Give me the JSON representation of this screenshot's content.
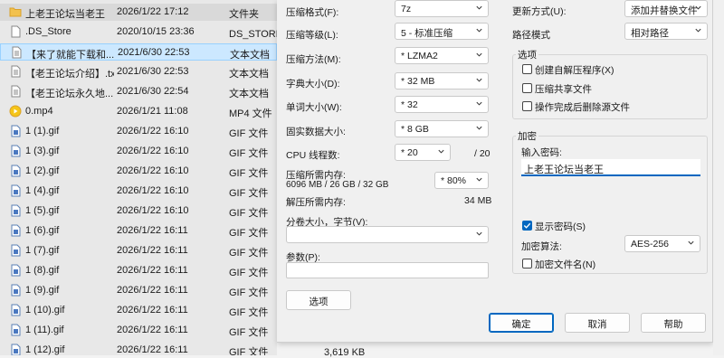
{
  "files": [
    {
      "name": "上老王论坛当老王",
      "date": "2026/1/22 17:12",
      "type": "文件夹",
      "icon": "folder-icon"
    },
    {
      "name": ".DS_Store",
      "date": "2020/10/15 23:36",
      "type": "DS_STORE 文件",
      "icon": "file-icon"
    },
    {
      "name": "【来了就能下载和...",
      "date": "2021/6/30 22:53",
      "type": "文本文档",
      "icon": "text-file-icon"
    },
    {
      "name": "【老王论坛介绍】.txt",
      "date": "2021/6/30 22:53",
      "type": "文本文档",
      "icon": "text-file-icon"
    },
    {
      "name": "【老王论坛永久地...",
      "date": "2021/6/30 22:54",
      "type": "文本文档",
      "icon": "text-file-icon"
    },
    {
      "name": "0.mp4",
      "date": "2026/1/21 11:08",
      "type": "MP4 文件",
      "icon": "video-file-icon"
    },
    {
      "name": "1 (1).gif",
      "date": "2026/1/22 16:10",
      "type": "GIF 文件",
      "icon": "gif-file-icon"
    },
    {
      "name": "1 (3).gif",
      "date": "2026/1/22 16:10",
      "type": "GIF 文件",
      "icon": "gif-file-icon"
    },
    {
      "name": "1 (2).gif",
      "date": "2026/1/22 16:10",
      "type": "GIF 文件",
      "icon": "gif-file-icon"
    },
    {
      "name": "1 (4).gif",
      "date": "2026/1/22 16:10",
      "type": "GIF 文件",
      "icon": "gif-file-icon"
    },
    {
      "name": "1 (5).gif",
      "date": "2026/1/22 16:10",
      "type": "GIF 文件",
      "icon": "gif-file-icon"
    },
    {
      "name": "1 (6).gif",
      "date": "2026/1/22 16:11",
      "type": "GIF 文件",
      "icon": "gif-file-icon"
    },
    {
      "name": "1 (7).gif",
      "date": "2026/1/22 16:11",
      "type": "GIF 文件",
      "icon": "gif-file-icon"
    },
    {
      "name": "1 (8).gif",
      "date": "2026/1/22 16:11",
      "type": "GIF 文件",
      "icon": "gif-file-icon"
    },
    {
      "name": "1 (9).gif",
      "date": "2026/1/22 16:11",
      "type": "GIF 文件",
      "icon": "gif-file-icon"
    },
    {
      "name": "1 (10).gif",
      "date": "2026/1/22 16:11",
      "type": "GIF 文件",
      "icon": "gif-file-icon"
    },
    {
      "name": "1 (11).gif",
      "date": "2026/1/22 16:11",
      "type": "GIF 文件",
      "icon": "gif-file-icon"
    },
    {
      "name": "1 (12).gif",
      "date": "2026/1/22 16:11",
      "type": "GIF 文件",
      "icon": "gif-file-icon"
    }
  ],
  "last_file_size": "3,619 KB",
  "dialog": {
    "format": {
      "label": "压缩格式(F):",
      "value": "7z"
    },
    "level": {
      "label": "压缩等级(L):",
      "value": "5 - 标准压缩"
    },
    "method": {
      "label": "压缩方法(M):",
      "value": "* LZMA2"
    },
    "dict": {
      "label": "字典大小(D):",
      "value": "* 32 MB"
    },
    "word": {
      "label": "单词大小(W):",
      "value": "* 32"
    },
    "solid": {
      "label": "固实数据大小:",
      "value": "* 8 GB"
    },
    "cpu": {
      "label": "CPU 线程数:",
      "value": "* 20",
      "max": "/ 20"
    },
    "mem": {
      "label": "压缩所需内存:",
      "detail": "6096 MB / 26 GB / 32 GB",
      "value": "* 80%"
    },
    "decomp": {
      "label": "解压所需内存:",
      "value": "34 MB"
    },
    "volume": {
      "label": "分卷大小，字节(V):",
      "value": ""
    },
    "params": {
      "label": "参数(P):",
      "value": ""
    },
    "options_button": "选项",
    "update": {
      "label": "更新方式(U):",
      "value": "添加并替换文件"
    },
    "path": {
      "label": "路径模式",
      "value": "相对路径"
    },
    "options_group": {
      "title": "选项",
      "sfx": {
        "label": "创建自解压程序(X)",
        "checked": false
      },
      "shared": {
        "label": "压缩共享文件",
        "checked": false
      },
      "delete": {
        "label": "操作完成后删除源文件",
        "checked": false
      }
    },
    "encryption": {
      "title": "加密",
      "pw_label": "输入密码:",
      "pw_value": "上老王论坛当老王",
      "show_pw": {
        "label": "显示密码(S)",
        "checked": true
      },
      "algo_label": "加密算法:",
      "algo_value": "AES-256",
      "encrypt_names": {
        "label": "加密文件名(N)",
        "checked": false
      }
    },
    "ok": "确定",
    "cancel": "取消",
    "help": "帮助"
  },
  "colors": {
    "accent": "#0067c0",
    "selection": "#cce8ff"
  }
}
